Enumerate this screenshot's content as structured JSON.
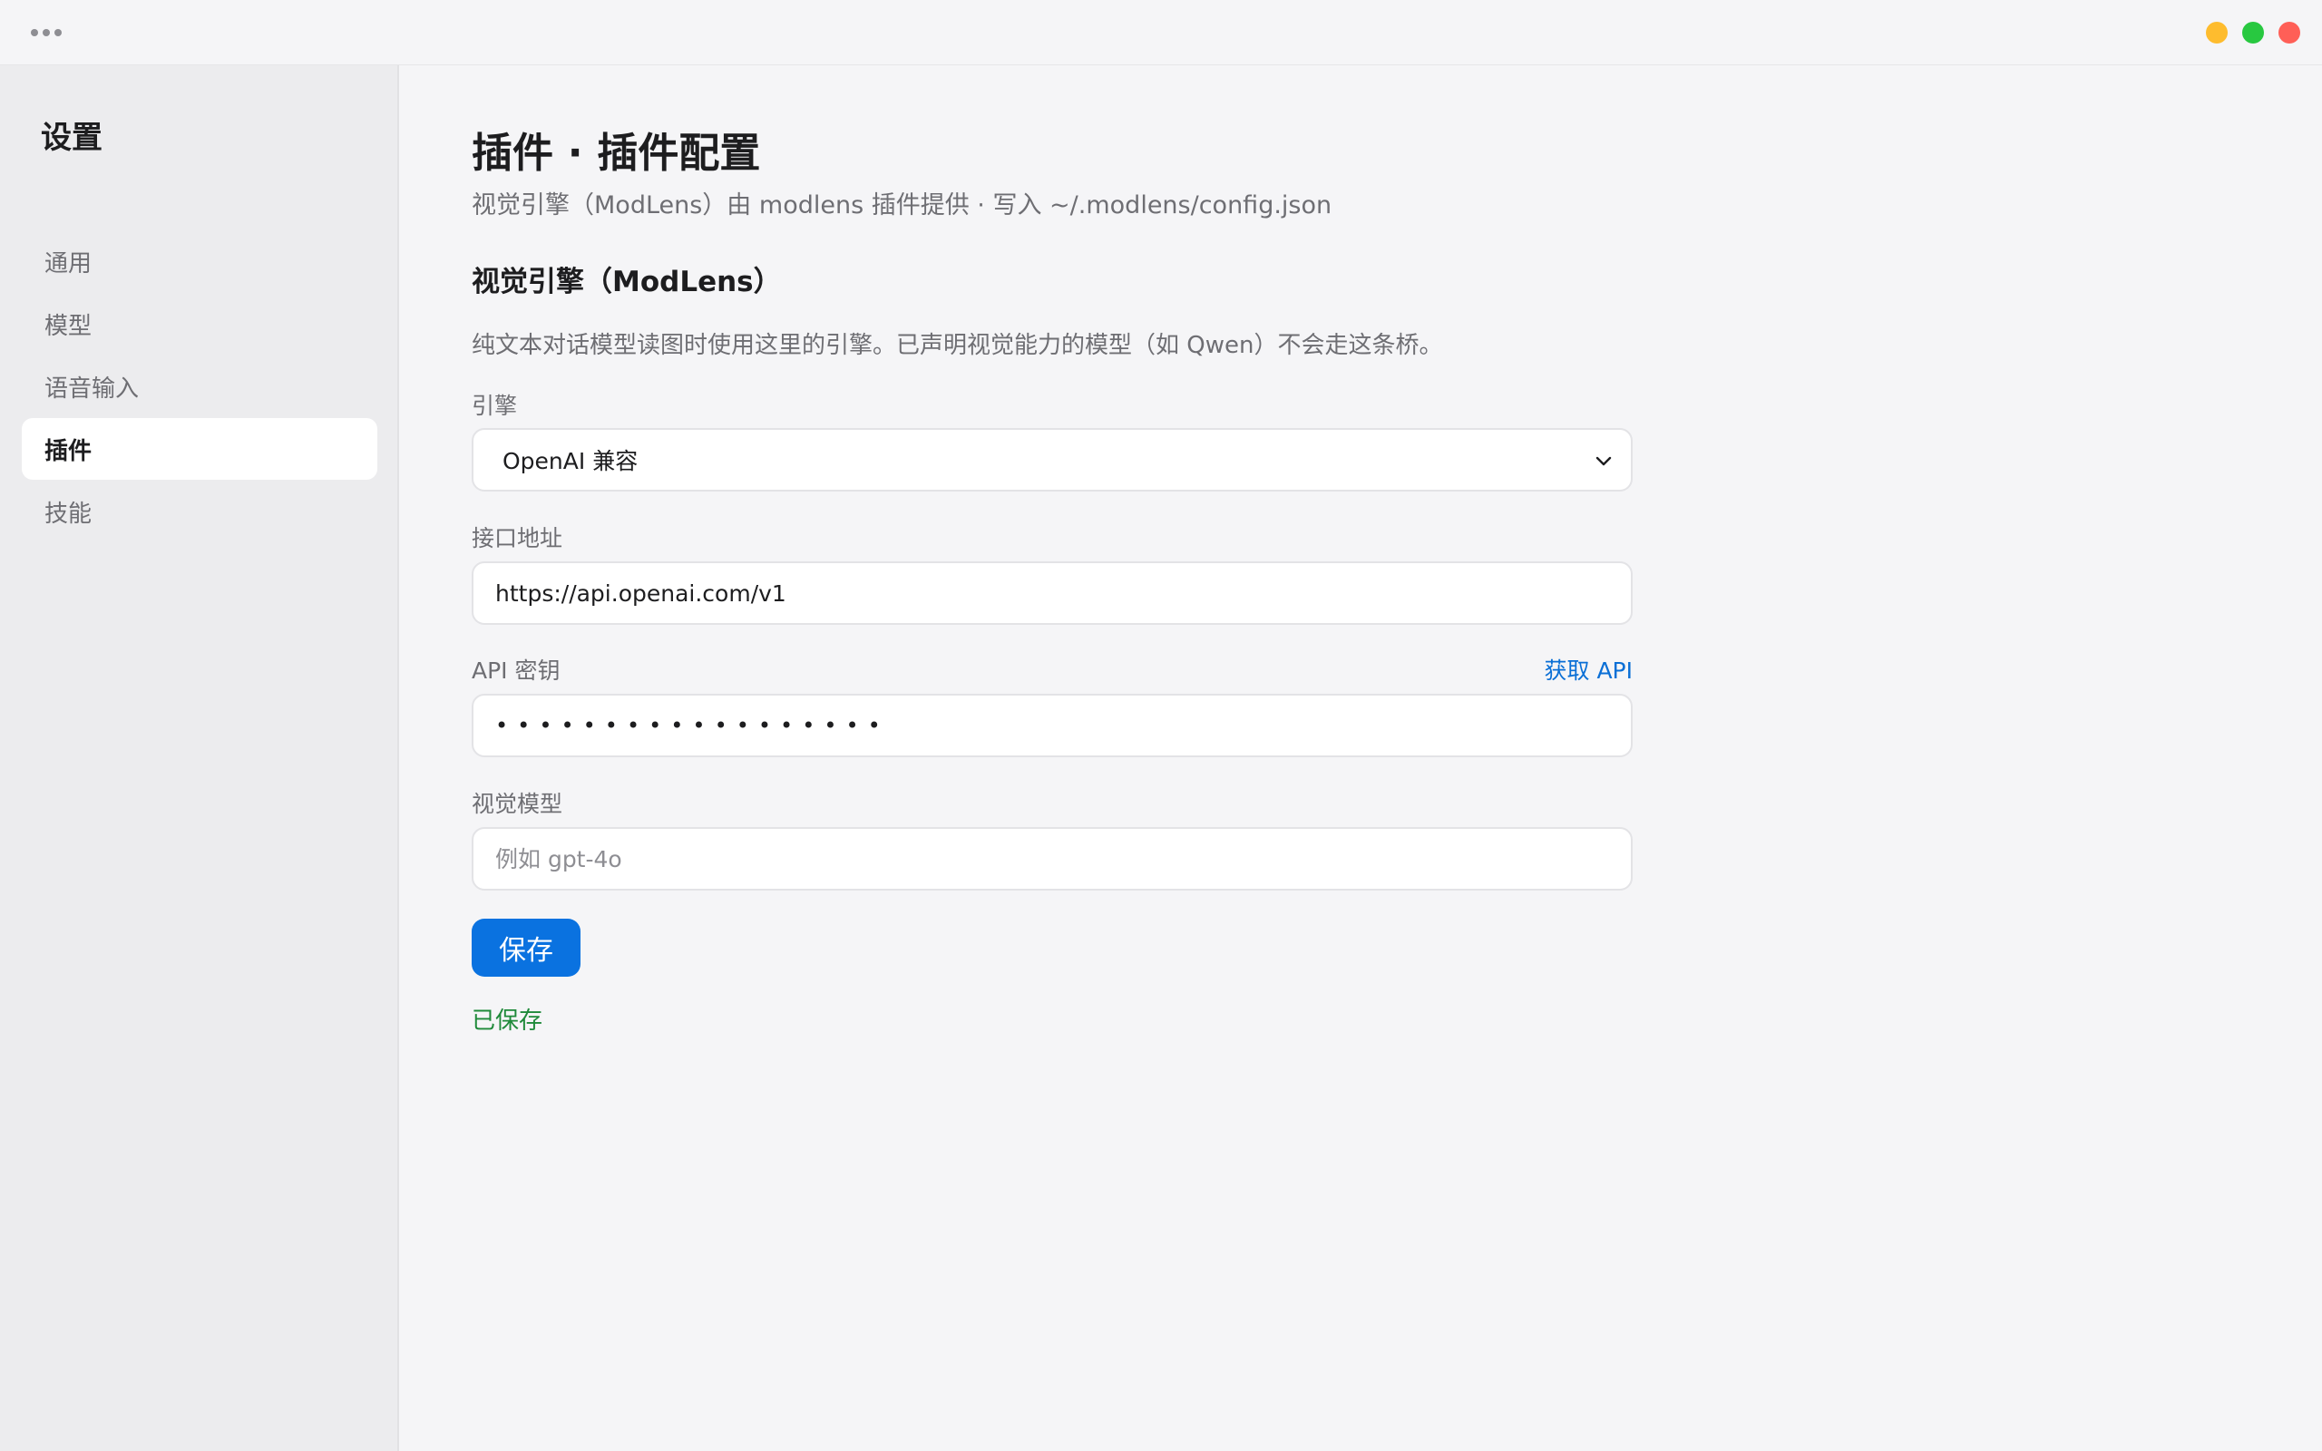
{
  "window": {
    "more_icon": "ellipsis-icon",
    "controls": [
      "minimize",
      "maximize",
      "close"
    ],
    "colors": {
      "minimize": "#febc2e",
      "maximize": "#28c840",
      "close": "#ff5f57"
    }
  },
  "sidebar": {
    "title": "设置",
    "items": [
      {
        "label": "通用",
        "active": false
      },
      {
        "label": "模型",
        "active": false
      },
      {
        "label": "语音输入",
        "active": false
      },
      {
        "label": "插件",
        "active": true
      },
      {
        "label": "技能",
        "active": false
      }
    ]
  },
  "main": {
    "title": "插件 · 插件配置",
    "subtitle": "视觉引擎（ModLens）由 modlens 插件提供 · 写入 ~/.modlens/config.json",
    "section_title": "视觉引擎（ModLens）",
    "section_desc": "纯文本对话模型读图时使用这里的引擎。已声明视觉能力的模型（如 Qwen）不会走这条桥。",
    "engine": {
      "label": "引擎",
      "value": "OpenAI 兼容"
    },
    "endpoint": {
      "label": "接口地址",
      "value": "https://api.openai.com/v1"
    },
    "api_key": {
      "label": "API 密钥",
      "value": "••••••••••••••••••",
      "link_label": "获取 API"
    },
    "vision_model": {
      "label": "视觉模型",
      "value": "",
      "placeholder": "例如 gpt-4o"
    },
    "save_label": "保存",
    "status": "已保存"
  },
  "colors": {
    "accent": "#0a72e0",
    "link": "#0a6fd6",
    "success": "#1f8a3a"
  }
}
